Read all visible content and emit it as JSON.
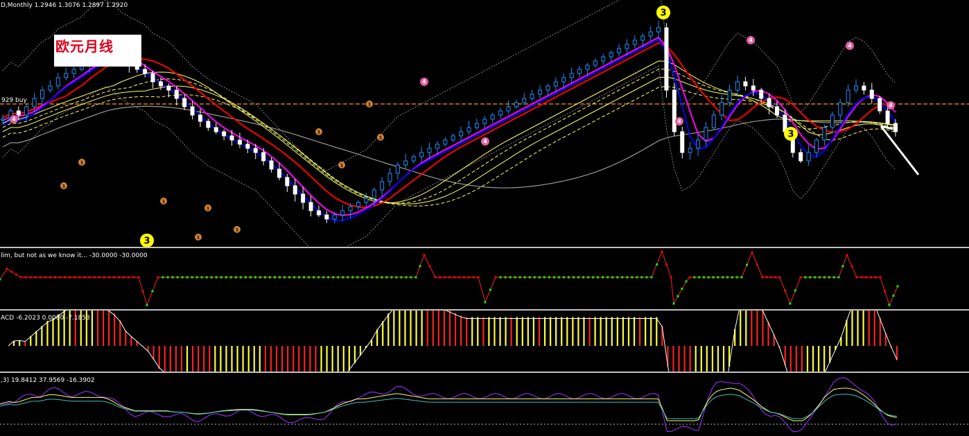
{
  "header": {
    "symbol_line": "D,Monthly  1.2946  1.3076  1.2897  1.2920",
    "level_label": "929 buy"
  },
  "overlay_title": "欧元月线",
  "markers": {
    "wave3": "3",
    "circle1": "1",
    "circle4": "4"
  },
  "panes": {
    "p1": {
      "label": "lim, but not as we know it...  -30.0000 -30.0000"
    },
    "p2": {
      "label": "ACD -6.2023 0.0000 -7.1853"
    },
    "p3": {
      "label": ",3) 19.8412 37.9569 -16.3902"
    }
  },
  "colors": {
    "bull": "#1e90ff",
    "bear": "#ffffff",
    "ma_fast": "#0000ff",
    "ma_mid": "#ff00ff",
    "ma_slow": "#ff0000",
    "band": "#ffff66",
    "level": "#ff9900"
  },
  "chart_data": {
    "type": "line",
    "title": "",
    "series": [
      {
        "values": [
          0.56,
          0.6,
          0.58,
          0.62,
          0.66,
          0.7,
          0.72,
          0.76,
          0.78,
          0.8,
          0.82,
          0.86,
          0.88,
          0.9,
          0.88,
          0.84,
          0.82,
          0.8,
          0.78,
          0.74,
          0.72,
          0.7,
          0.66,
          0.62,
          0.58,
          0.55,
          0.52,
          0.5,
          0.48,
          0.46,
          0.44,
          0.42,
          0.4,
          0.36,
          0.32,
          0.28,
          0.24,
          0.2,
          0.16,
          0.12,
          0.1,
          0.08,
          0.1,
          0.12,
          0.14,
          0.16,
          0.18,
          0.22,
          0.26,
          0.3,
          0.34,
          0.36,
          0.38,
          0.4,
          0.42,
          0.44,
          0.46,
          0.48,
          0.5,
          0.52,
          0.54,
          0.56,
          0.58,
          0.6,
          0.62,
          0.64,
          0.66,
          0.68,
          0.7,
          0.72,
          0.74,
          0.76,
          0.78,
          0.8,
          0.82,
          0.84,
          0.86,
          0.88,
          0.9,
          0.92,
          0.94,
          0.96,
          0.98,
          1.0,
          0.7,
          0.5,
          0.4,
          0.42,
          0.46,
          0.52,
          0.58,
          0.64,
          0.7,
          0.74,
          0.72,
          0.7,
          0.66,
          0.62,
          0.58,
          0.5,
          0.4,
          0.36,
          0.4,
          0.46,
          0.52,
          0.58,
          0.64,
          0.7,
          0.72,
          0.7,
          0.66,
          0.6,
          0.54,
          0.5
        ]
      }
    ]
  }
}
